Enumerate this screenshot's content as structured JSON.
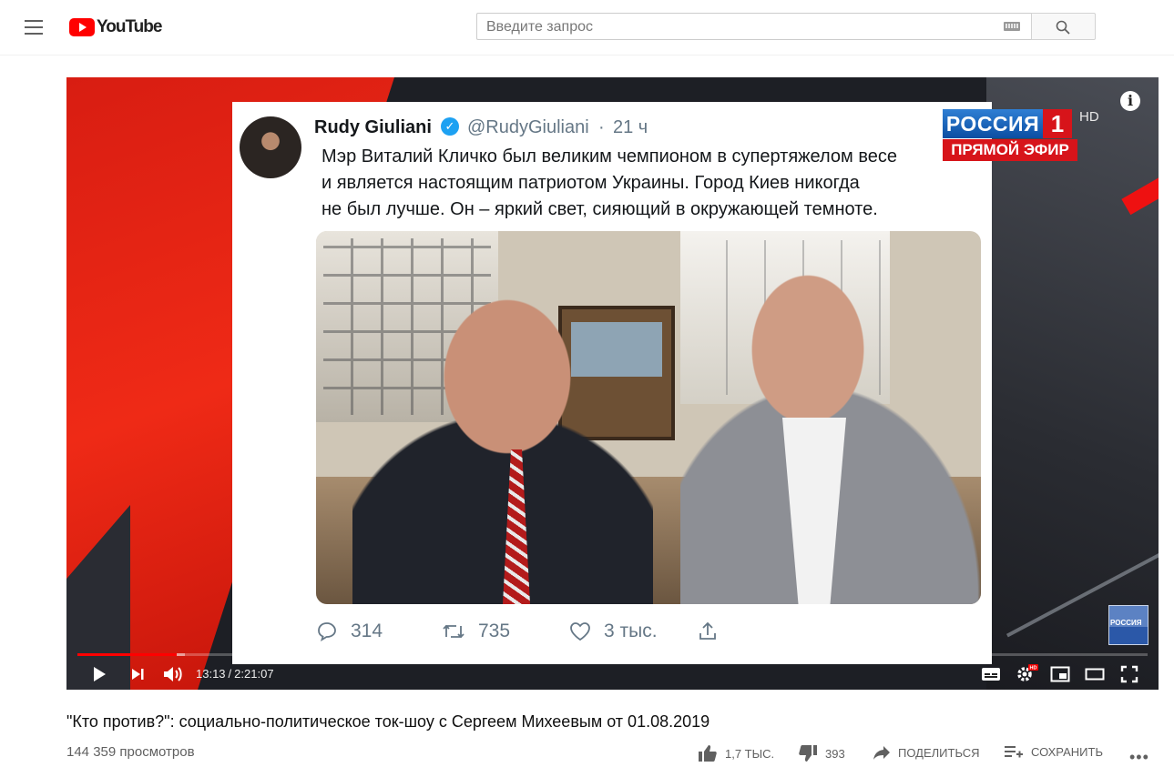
{
  "masthead": {
    "logo_text": "YouTube",
    "search_placeholder": "Введите запрос"
  },
  "player": {
    "tweet": {
      "name": "Rudy Giuliani",
      "handle": "@RudyGiuliani",
      "dot": "·",
      "time": "21 ч",
      "text": "Мэр Виталий Кличко был великим чемпионом в супертяжелом весе\nи является настоящим патриотом Украины. Город Киев никогда\nне был лучше. Он – яркий свет, сияющий в окружающей темноте.",
      "replies": "314",
      "retweets": "735",
      "likes": "3 тыс."
    },
    "channel": {
      "name": "РОССИЯ",
      "number": "1",
      "hd": "HD",
      "live": "ПРЯМОЙ ЭФИР",
      "corner": "РОССИЯ"
    },
    "time_current": "13:13",
    "time_separator": "/",
    "time_total": "2:21:07",
    "progress_fraction": 0.0931,
    "buffer_fraction": 0.1
  },
  "video": {
    "title": "\"Кто против?\": социально-политическое ток-шоу с Сергеем Михеевым от 01.08.2019",
    "views": "144 359 просмотров",
    "likes": "1,7 ТЫС.",
    "dislikes": "393",
    "share": "ПОДЕЛИТЬСЯ",
    "save": "СОХРАНИТЬ",
    "more": "•••"
  },
  "colors": {
    "brand_red": "#ff0000",
    "twitter_blue": "#1da1f2",
    "channel_red": "#d7141a"
  }
}
